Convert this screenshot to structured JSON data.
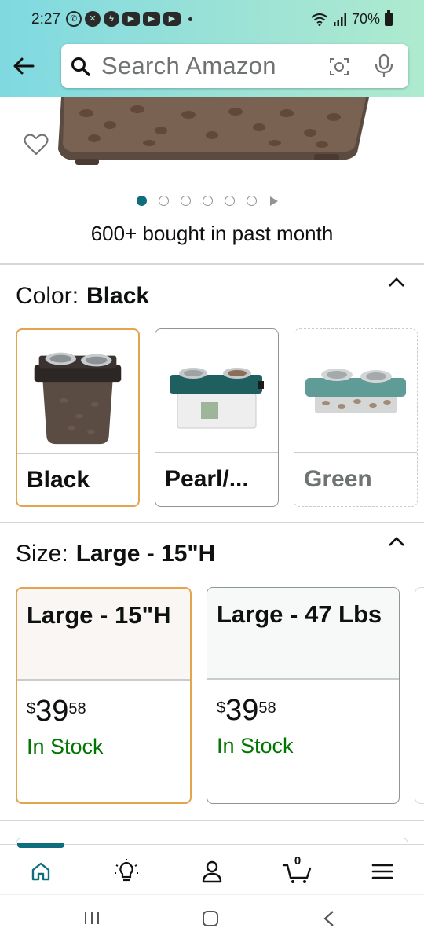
{
  "status_bar": {
    "time": "2:27",
    "battery": "70%",
    "icons": [
      "whatsapp-icon",
      "x-icon",
      "messenger-icon",
      "youtube-icon",
      "youtube-icon",
      "youtube-icon"
    ]
  },
  "header": {
    "search_placeholder": "Search Amazon",
    "back_icon": "arrow-left-icon",
    "camera_icon": "camera-scan-icon",
    "mic_icon": "microphone-icon",
    "accent": "#7fd9e1"
  },
  "product": {
    "bought_text": "600+ bought in past month",
    "image_count": 6,
    "active_image": 1
  },
  "color_section": {
    "label": "Color:",
    "selected": "Black",
    "options": [
      {
        "name": "Black",
        "state": "selected"
      },
      {
        "name": "Pearl/...",
        "state": "available"
      },
      {
        "name": "Green",
        "state": "unavailable"
      }
    ]
  },
  "size_section": {
    "label": "Size:",
    "selected": "Large - 15\"H",
    "options": [
      {
        "name": "Large - 15\"H",
        "price_symbol": "$",
        "price_whole": "39",
        "price_fraction": "58",
        "stock": "In Stock",
        "state": "selected"
      },
      {
        "name": "Large - 47 Lbs",
        "price_symbol": "$",
        "price_whole": "39",
        "price_fraction": "58",
        "stock": "In Stock",
        "state": "available"
      }
    ]
  },
  "bottom_nav": {
    "items": [
      "home-icon",
      "lightbulb-icon",
      "account-icon",
      "cart-icon",
      "menu-icon"
    ],
    "cart_count": "0",
    "active": "home",
    "accent": "#0f6e7e"
  },
  "system_nav": {
    "items": [
      "recents-icon",
      "home-circle-icon",
      "back-chevron-icon"
    ]
  },
  "colors": {
    "stock_green": "#007600",
    "selected_border": "#e3a44e",
    "teal": "#0f6e7e"
  }
}
